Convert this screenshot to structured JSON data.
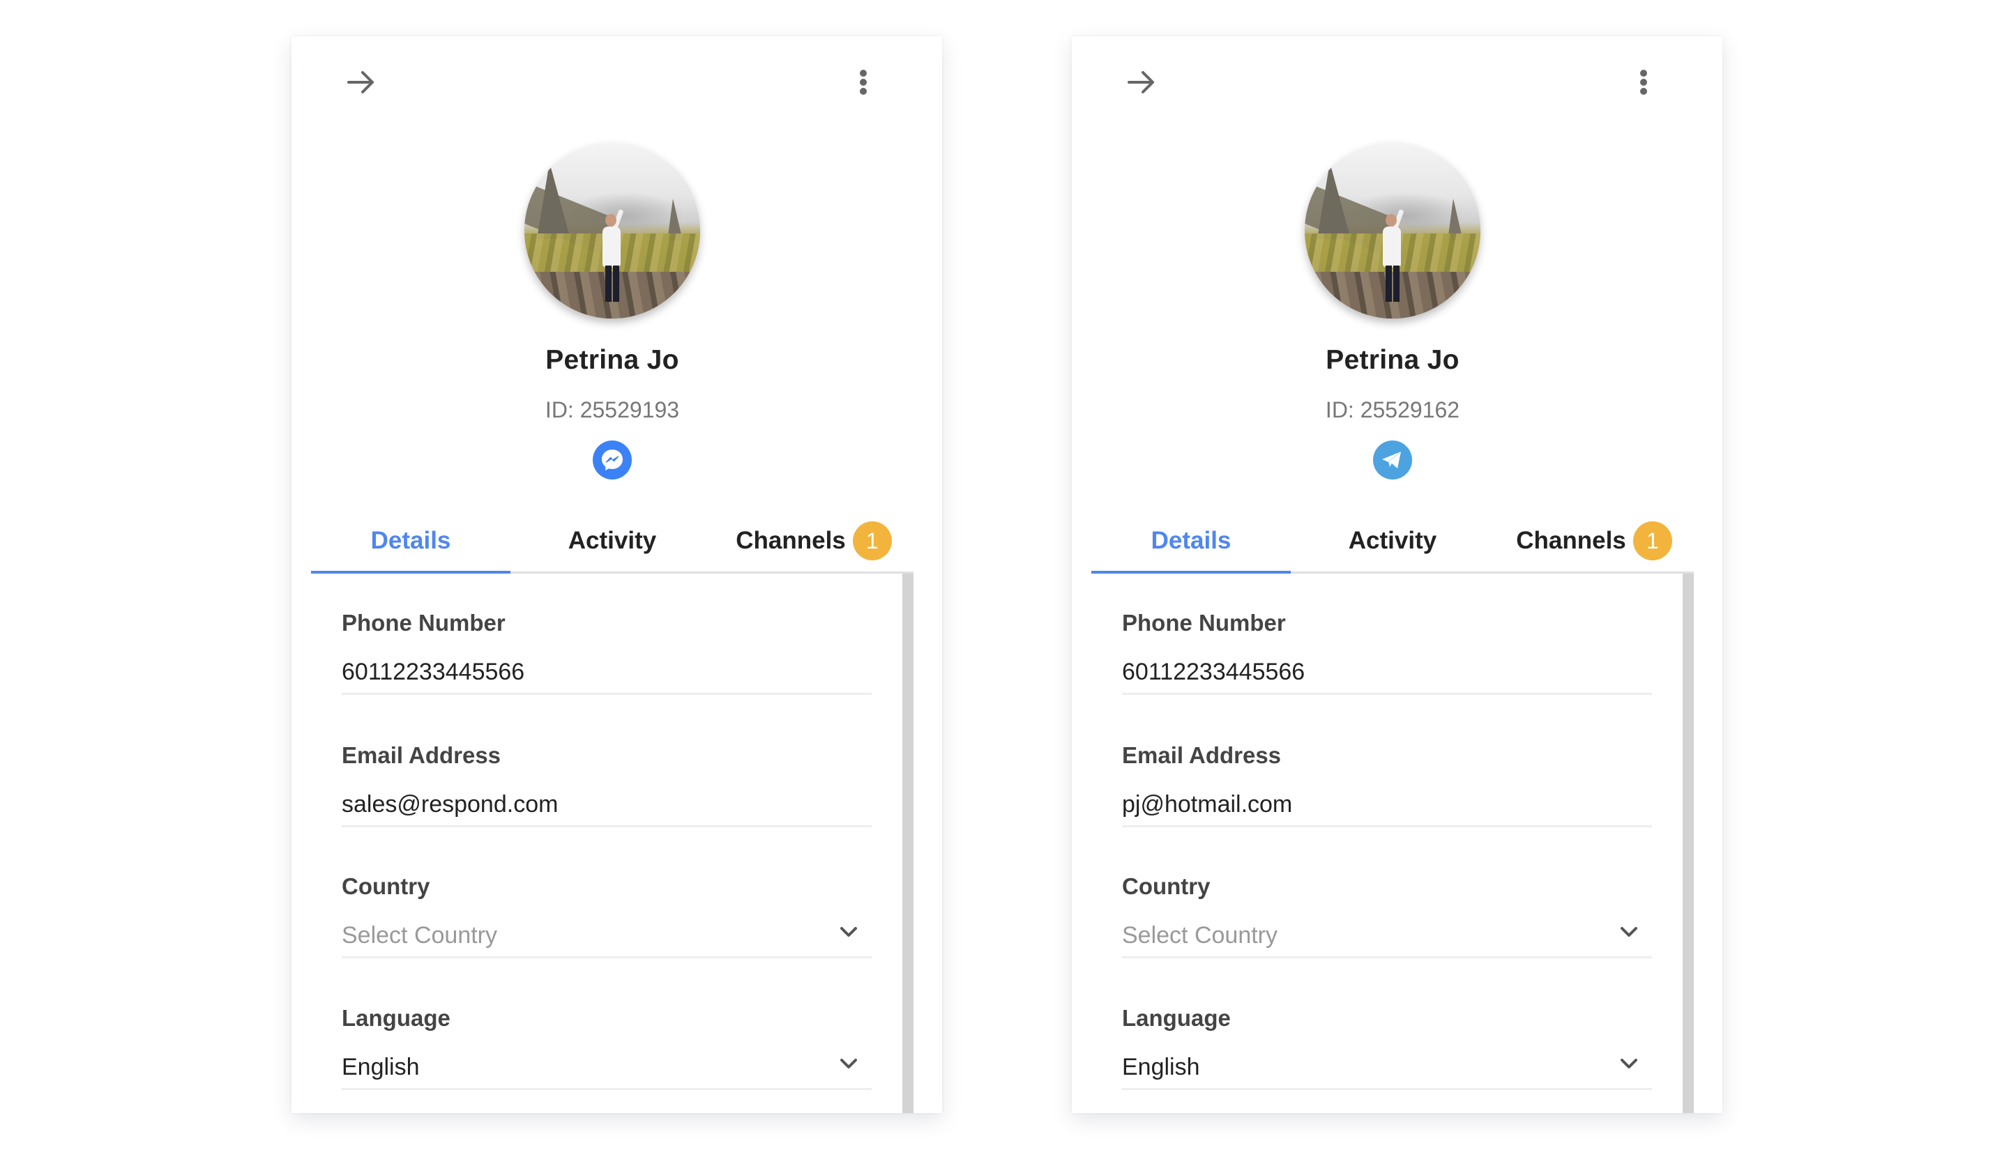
{
  "colors": {
    "accent_blue": "#4f86f0",
    "badge_orange": "#f2b43c",
    "messenger_blue": "#3b82f6",
    "telegram_blue": "#4da3e0"
  },
  "cards": [
    {
      "back_icon": "arrow-right-icon",
      "menu_icon": "more-vertical-icon",
      "name": "Petrina Jo",
      "id_text": "ID: 25529193",
      "channel_icon": "messenger-icon",
      "tabs": [
        {
          "label": "Details",
          "active": true
        },
        {
          "label": "Activity",
          "active": false
        },
        {
          "label": "Channels",
          "active": false,
          "badge": "1"
        }
      ],
      "fields": {
        "phone": {
          "label": "Phone Number",
          "value": "60112233445566"
        },
        "email": {
          "label": "Email Address",
          "value": "sales@respond.com"
        },
        "country": {
          "label": "Country",
          "value": "",
          "placeholder": "Select Country"
        },
        "language": {
          "label": "Language",
          "value": "English"
        }
      }
    },
    {
      "back_icon": "arrow-right-icon",
      "menu_icon": "more-vertical-icon",
      "name": "Petrina Jo",
      "id_text": "ID: 25529162",
      "channel_icon": "telegram-icon",
      "tabs": [
        {
          "label": "Details",
          "active": true
        },
        {
          "label": "Activity",
          "active": false
        },
        {
          "label": "Channels",
          "active": false,
          "badge": "1"
        }
      ],
      "fields": {
        "phone": {
          "label": "Phone Number",
          "value": "60112233445566"
        },
        "email": {
          "label": "Email Address",
          "value": "pj@hotmail.com"
        },
        "country": {
          "label": "Country",
          "value": "",
          "placeholder": "Select Country"
        },
        "language": {
          "label": "Language",
          "value": "English"
        }
      }
    }
  ]
}
